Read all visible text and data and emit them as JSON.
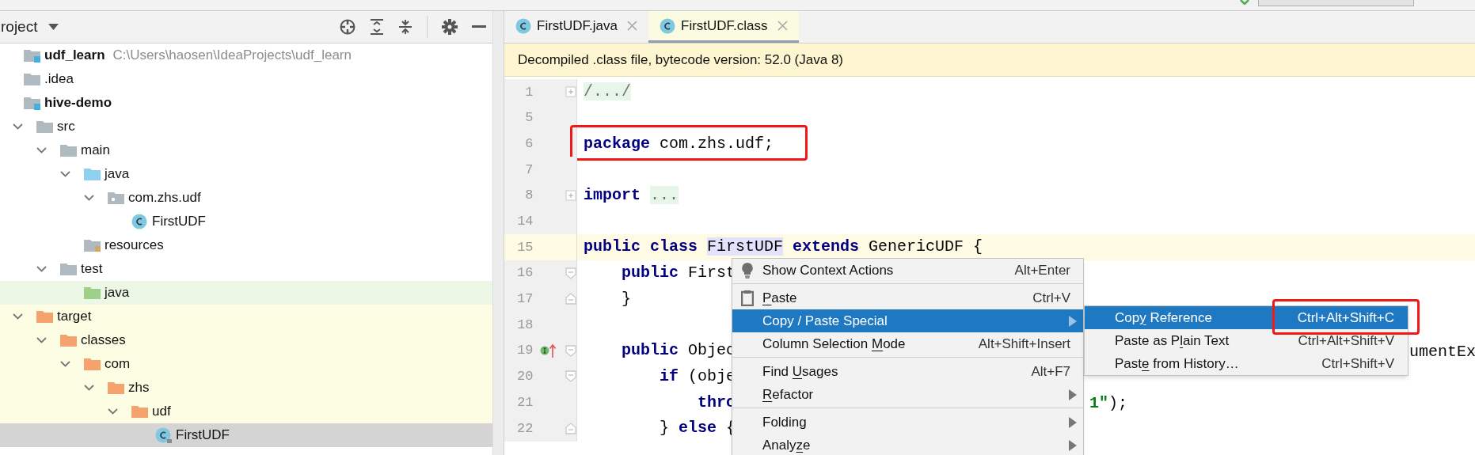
{
  "project_panel": {
    "title": "roject",
    "tree": [
      {
        "label": "udf_learn",
        "kind": "module",
        "bold": true,
        "selected": false,
        "path": "C:\\Users\\haosen\\IdeaProjects\\udf_learn",
        "children": [
          {
            "label": ".idea",
            "kind": "folder",
            "bold": false,
            "selected": false
          },
          {
            "label": "hive-demo",
            "kind": "module",
            "bold": true,
            "selected": false,
            "children": [
              {
                "label": "src",
                "kind": "folder",
                "bold": false,
                "selected": false,
                "expanded": true,
                "children": [
                  {
                    "label": "main",
                    "kind": "folder",
                    "bold": false,
                    "selected": false,
                    "expanded": true,
                    "children": [
                      {
                        "label": "java",
                        "kind": "source-root",
                        "bold": false,
                        "selected": false,
                        "expanded": true,
                        "children": [
                          {
                            "label": "com.zhs.udf",
                            "kind": "package",
                            "bold": false,
                            "selected": false,
                            "expanded": true,
                            "children": [
                              {
                                "label": "FirstUDF",
                                "kind": "class",
                                "bold": false,
                                "selected": false
                              }
                            ]
                          }
                        ]
                      },
                      {
                        "label": "resources",
                        "kind": "resources-root",
                        "bold": false,
                        "selected": false
                      }
                    ]
                  },
                  {
                    "label": "test",
                    "kind": "folder",
                    "bold": false,
                    "selected": false,
                    "expanded": true,
                    "children": [
                      {
                        "label": "java",
                        "kind": "test-root",
                        "bold": false,
                        "selected": false,
                        "color": "#edf7e5"
                      }
                    ]
                  }
                ]
              },
              {
                "label": "target",
                "kind": "excluded",
                "bold": false,
                "selected": false,
                "expanded": true,
                "color": "#fdfde3",
                "children": [
                  {
                    "label": "classes",
                    "kind": "excluded",
                    "bold": false,
                    "selected": false,
                    "expanded": true,
                    "children": [
                      {
                        "label": "com",
                        "kind": "excluded",
                        "bold": false,
                        "selected": false,
                        "expanded": true,
                        "children": [
                          {
                            "label": "zhs",
                            "kind": "excluded",
                            "bold": false,
                            "selected": false,
                            "expanded": true,
                            "children": [
                              {
                                "label": "udf",
                                "kind": "excluded",
                                "bold": false,
                                "selected": false,
                                "expanded": true,
                                "children": [
                                  {
                                    "label": "FirstUDF",
                                    "kind": "class-locked",
                                    "bold": false,
                                    "selected": true
                                  }
                                ]
                              }
                            ]
                          }
                        ]
                      }
                    ]
                  }
                ]
              }
            ]
          }
        ]
      }
    ]
  },
  "tabs": [
    {
      "label": "FirstUDF.java",
      "selected": false
    },
    {
      "label": "FirstUDF.class",
      "selected": true
    }
  ],
  "banner": "Decompiled .class file, bytecode version: 52.0 (Java 8)",
  "code_lines": [
    {
      "number": "1",
      "fold_marker": {
        "kind": "expand"
      },
      "current": false,
      "boxed": false,
      "tokens": [
        {
          "text": "/.../",
          "kind": "folded"
        }
      ]
    },
    {
      "number": "5",
      "current": false,
      "boxed": false
    },
    {
      "number": "6",
      "current": false,
      "boxed": true,
      "tokens": [
        {
          "text": "package",
          "kind": "keyword"
        },
        {
          "text": " com.zhs.udf;",
          "kind": "plain"
        }
      ]
    },
    {
      "number": "7",
      "current": false,
      "boxed": false
    },
    {
      "number": "8",
      "fold_marker": {
        "kind": "expand"
      },
      "current": false,
      "boxed": false,
      "tokens": [
        {
          "text": "import ",
          "kind": "keyword"
        },
        {
          "text": "...",
          "kind": "folded"
        }
      ]
    },
    {
      "number": "14",
      "current": false,
      "boxed": false
    },
    {
      "number": "15",
      "current": true,
      "boxed": false,
      "tokens": [
        {
          "text": "public class ",
          "kind": "keyword"
        },
        {
          "text": "FirstUDF",
          "kind": "usage"
        },
        {
          "text": " extends",
          "kind": "keyword"
        },
        {
          "text": " GenericUDF {",
          "kind": "plain"
        }
      ]
    },
    {
      "number": "16",
      "fold_marker": {
        "kind": "start"
      },
      "current": false,
      "boxed": false,
      "tokens": [
        {
          "text": "    public",
          "kind": "keyword"
        },
        {
          "text": " First",
          "kind": "plain"
        }
      ]
    },
    {
      "number": "17",
      "fold_marker": {
        "kind": "end"
      },
      "current": false,
      "boxed": false,
      "tokens": [
        {
          "text": "    }",
          "kind": "plain"
        }
      ]
    },
    {
      "number": "18",
      "current": false,
      "boxed": false
    },
    {
      "number": "19",
      "fold_marker": {
        "kind": "start"
      },
      "gutter_marker": {
        "kind": "implements"
      },
      "current": false,
      "boxed": false,
      "tokens": [
        {
          "text": "    public",
          "kind": "keyword"
        },
        {
          "text": " Objec",
          "kind": "plain"
        }
      ],
      "right": {
        "kind": "after-submenu",
        "tokens": [
          {
            "text": "umentEx",
            "kind": "plain"
          }
        ]
      }
    },
    {
      "number": "20",
      "fold_marker": {
        "kind": "start"
      },
      "current": false,
      "boxed": false,
      "tokens": [
        {
          "text": "        if",
          "kind": "keyword"
        },
        {
          "text": " (obje",
          "kind": "plain"
        }
      ]
    },
    {
      "number": "21",
      "current": false,
      "boxed": false,
      "tokens": [
        {
          "text": "            thro",
          "kind": "keyword"
        }
      ],
      "right": {
        "kind": "after-menu",
        "tokens": [
          {
            "text": "1\"",
            "kind": "string"
          },
          {
            "text": ");",
            "kind": "plain"
          }
        ]
      }
    },
    {
      "number": "22",
      "fold_marker": {
        "kind": "end"
      },
      "current": false,
      "boxed": false,
      "tokens": [
        {
          "text": "        } ",
          "kind": "plain"
        },
        {
          "text": "else",
          "kind": "keyword"
        },
        {
          "text": " {",
          "kind": "plain"
        }
      ]
    }
  ],
  "context_menu": {
    "items": [
      {
        "kind": "intention",
        "selected": false,
        "has_submenu": false,
        "label": [
          {
            "text": "Show Context Actions",
            "mnemonic": false
          }
        ],
        "shortcut": "Alt+Enter"
      },
      {
        "kind": "separator"
      },
      {
        "kind": "paste",
        "selected": false,
        "has_submenu": false,
        "label": [
          {
            "text": "P",
            "mnemonic": true
          },
          {
            "text": "aste",
            "mnemonic": false
          }
        ],
        "shortcut": "Ctrl+V"
      },
      {
        "kind": "item",
        "selected": true,
        "has_submenu": true,
        "label": [
          {
            "text": "Copy / Paste Special",
            "mnemonic": false
          }
        ],
        "submenu": [
          {
            "selected": true,
            "shortcut_boxed": true,
            "label": [
              {
                "text": "Cop",
                "mnemonic": false
              },
              {
                "text": "y",
                "mnemonic": true
              },
              {
                "text": " Reference",
                "mnemonic": false
              }
            ],
            "shortcut": "Ctrl+Alt+Shift+C"
          },
          {
            "selected": false,
            "shortcut_boxed": false,
            "label": [
              {
                "text": "Paste as P",
                "mnemonic": false
              },
              {
                "text": "l",
                "mnemonic": true
              },
              {
                "text": "ain Text",
                "mnemonic": false
              }
            ],
            "shortcut": "Ctrl+Alt+Shift+V"
          },
          {
            "selected": false,
            "shortcut_boxed": false,
            "label": [
              {
                "text": "Past",
                "mnemonic": false
              },
              {
                "text": "e",
                "mnemonic": true
              },
              {
                "text": " from History…",
                "mnemonic": false
              }
            ],
            "shortcut": "Ctrl+Shift+V"
          }
        ]
      },
      {
        "kind": "item",
        "selected": false,
        "has_submenu": false,
        "label": [
          {
            "text": "Column Selection ",
            "mnemonic": false
          },
          {
            "text": "M",
            "mnemonic": true
          },
          {
            "text": "ode",
            "mnemonic": false
          }
        ],
        "shortcut": "Alt+Shift+Insert"
      },
      {
        "kind": "separator"
      },
      {
        "kind": "item",
        "selected": false,
        "has_submenu": false,
        "label": [
          {
            "text": "Find ",
            "mnemonic": false
          },
          {
            "text": "U",
            "mnemonic": true
          },
          {
            "text": "sages",
            "mnemonic": false
          }
        ],
        "shortcut": "Alt+F7"
      },
      {
        "kind": "item",
        "selected": false,
        "has_submenu": true,
        "label": [
          {
            "text": "R",
            "mnemonic": true
          },
          {
            "text": "efactor",
            "mnemonic": false
          }
        ]
      },
      {
        "kind": "separator"
      },
      {
        "kind": "item",
        "selected": false,
        "has_submenu": true,
        "label": [
          {
            "text": "Folding",
            "mnemonic": false
          }
        ]
      },
      {
        "kind": "item",
        "selected": false,
        "has_submenu": true,
        "label": [
          {
            "text": "Analy",
            "mnemonic": false
          },
          {
            "text": "z",
            "mnemonic": true
          },
          {
            "text": "e",
            "mnemonic": false
          }
        ]
      }
    ]
  }
}
